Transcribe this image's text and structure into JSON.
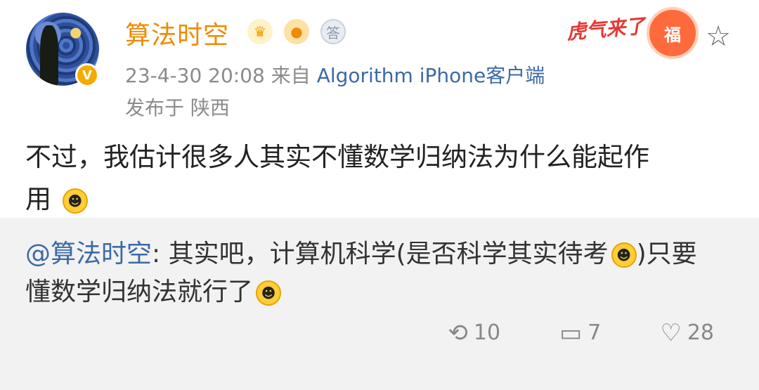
{
  "user": {
    "name": "算法时空",
    "verified_symbol": "V",
    "badges": [
      "crown-badge",
      "fish-badge",
      "answer-badge"
    ],
    "badge_glyphs": [
      "♛",
      "●",
      "答"
    ]
  },
  "post": {
    "time": "23-4-30 20:08",
    "source_prefix": "来自",
    "source_client": "Algorithm iPhone客户端",
    "location": "发布于 陕西",
    "content_line_1": "不过，我估计很多人其实不懂数学归纳法为什么能起作",
    "content_line_2": "用"
  },
  "sticker": {
    "text": "虎气来了",
    "paw_text": "福"
  },
  "actions": {
    "repost_count": "10",
    "comment_count": "7",
    "like_count": "28"
  },
  "repost": {
    "mention": "@算法时空",
    "text_part_1": ": 其实吧，计算机科学(是否科学其实待考",
    "text_part_2": ")只要",
    "line_2": "懂数学归纳法就行了"
  },
  "icons": {
    "star": "☆",
    "repost": "⟲",
    "comment": "▭",
    "like": "♡",
    "emoji": "☻"
  },
  "colors": {
    "username": "#f08a00",
    "link": "#3b6aa6",
    "meta": "#8b8b8b",
    "panel": "#f2f2f2",
    "verified": "#f4ab00"
  }
}
